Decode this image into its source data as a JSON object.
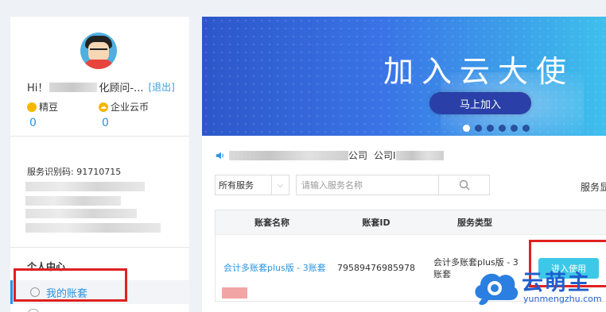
{
  "user": {
    "greeting_prefix": "Hi！",
    "greeting_suffix": "化顾问-...",
    "logout": "[退出]",
    "stats": [
      {
        "label": "精豆",
        "value": "0",
        "icon": "bean-icon"
      },
      {
        "label": "企业云币",
        "value": "0",
        "icon": "cloud-coin-icon"
      }
    ],
    "service_id": "服务识别码: 91710715"
  },
  "sidebar": {
    "section_title": "个人中心",
    "items": [
      {
        "label": "我的账套",
        "icon": "user-icon",
        "active": true
      }
    ]
  },
  "banner": {
    "title": "加入云大使",
    "button": "马上加入",
    "slide_count": 6,
    "active_slide": 0
  },
  "notice": {
    "icon": "speaker-icon",
    "part1": "公司",
    "part2": "公司I"
  },
  "filter": {
    "select_value": "所有服务",
    "search_placeholder": "请输入服务名称",
    "right_label": "服务显"
  },
  "table": {
    "headers": [
      "账套名称",
      "账套ID",
      "服务类型"
    ],
    "rows": [
      {
        "name": "会计多账套plus版 - 3账套",
        "id": "79589476985978",
        "type": "会计多账套plus版 - 3账套",
        "action": "进入使用"
      }
    ]
  },
  "watermark": {
    "brand": "云萌主",
    "url": "yunmengzhu.com"
  },
  "colors": {
    "accent": "#2a93e0",
    "highlight_box": "#e02020",
    "enter_button": "#3ec8e8"
  }
}
